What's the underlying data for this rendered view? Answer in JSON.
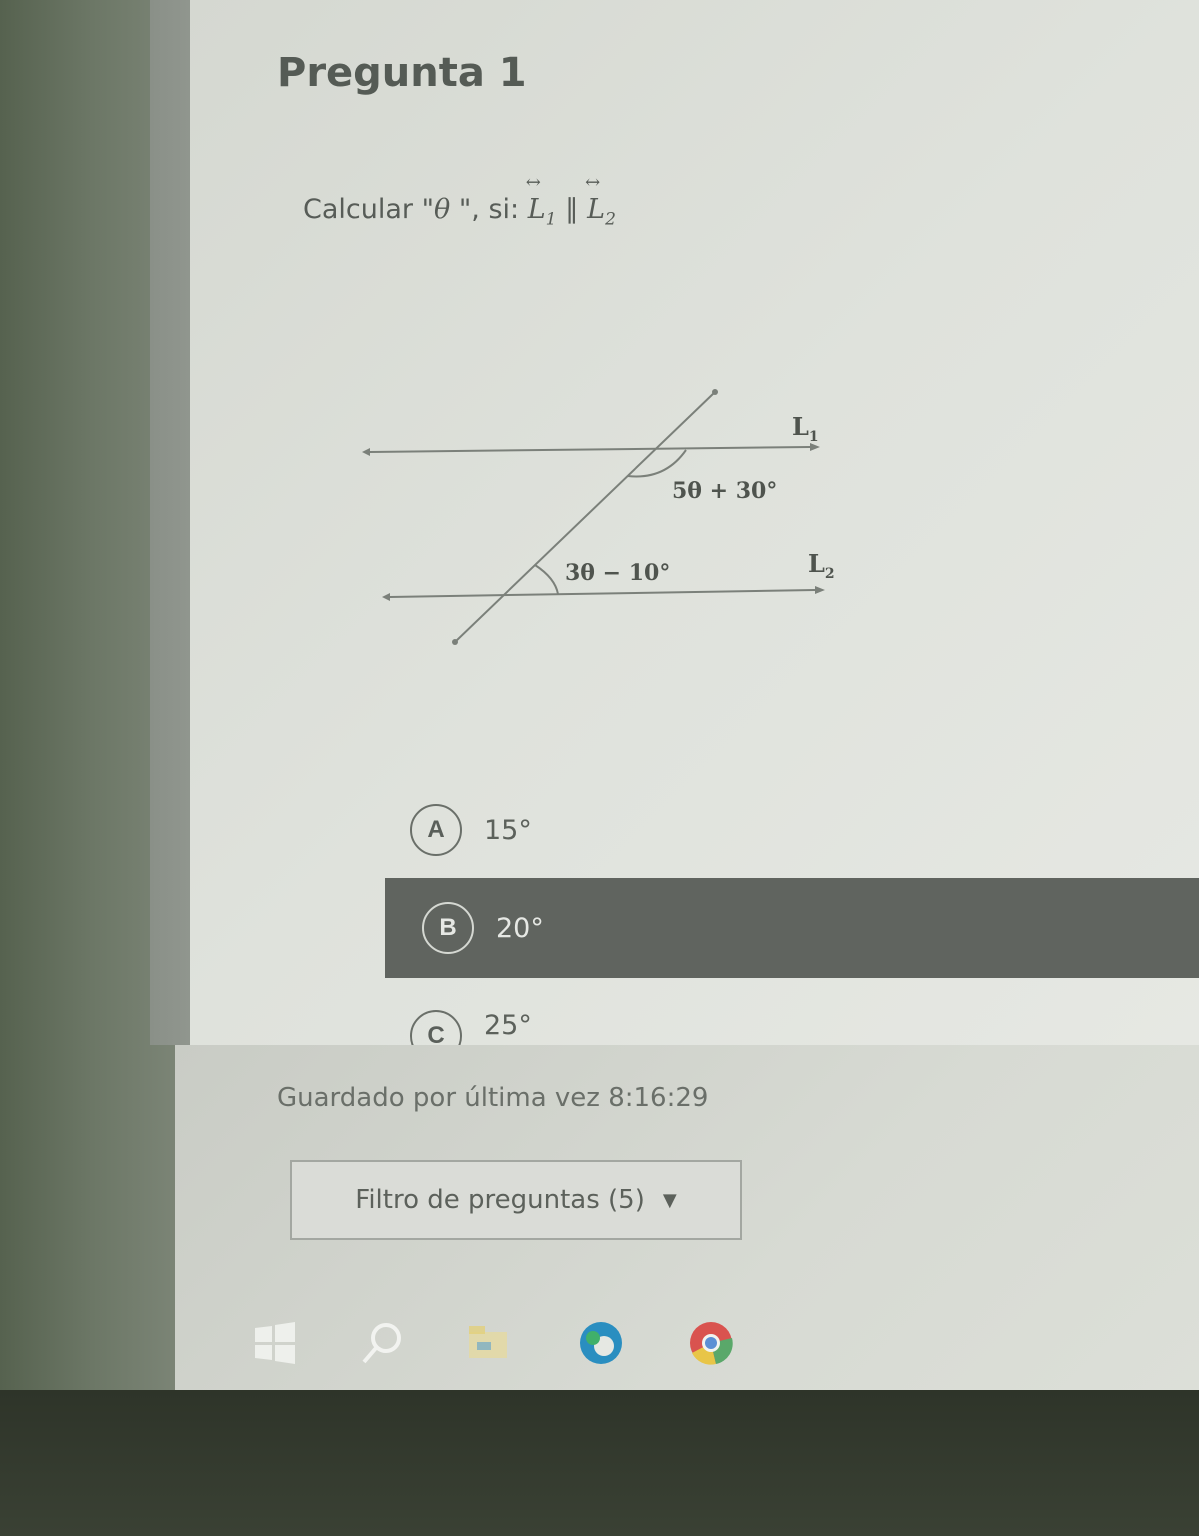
{
  "question": {
    "title": "Pregunta 1",
    "prompt_prefix": "Calcular \"",
    "theta": "θ",
    "prompt_mid": " \", si: ",
    "line1": "L",
    "line1_sub": "1",
    "parallel": " ∥ ",
    "line2": "L",
    "line2_sub": "2",
    "arrow": "↔"
  },
  "figure": {
    "label_l1": "L",
    "label_l1_sub": "1",
    "label_l2": "L",
    "label_l2_sub": "2",
    "angle_top": "5θ + 30°",
    "angle_bottom": "3θ − 10°"
  },
  "options": [
    {
      "letter": "A",
      "value": "15°"
    },
    {
      "letter": "B",
      "value": "20°"
    },
    {
      "letter": "C",
      "value": "25°"
    }
  ],
  "footer": {
    "saved": "Guardado por última vez 8:16:29",
    "filter_label": "Filtro de preguntas (5)",
    "filter_caret": "▼"
  },
  "colors": {
    "selected_option_bg": "#60645f",
    "screen_bg": "#dfe2dc"
  },
  "taskbar": [
    "windows-start-icon",
    "search-icon",
    "file-explorer-icon",
    "edge-icon",
    "chrome-icon"
  ]
}
